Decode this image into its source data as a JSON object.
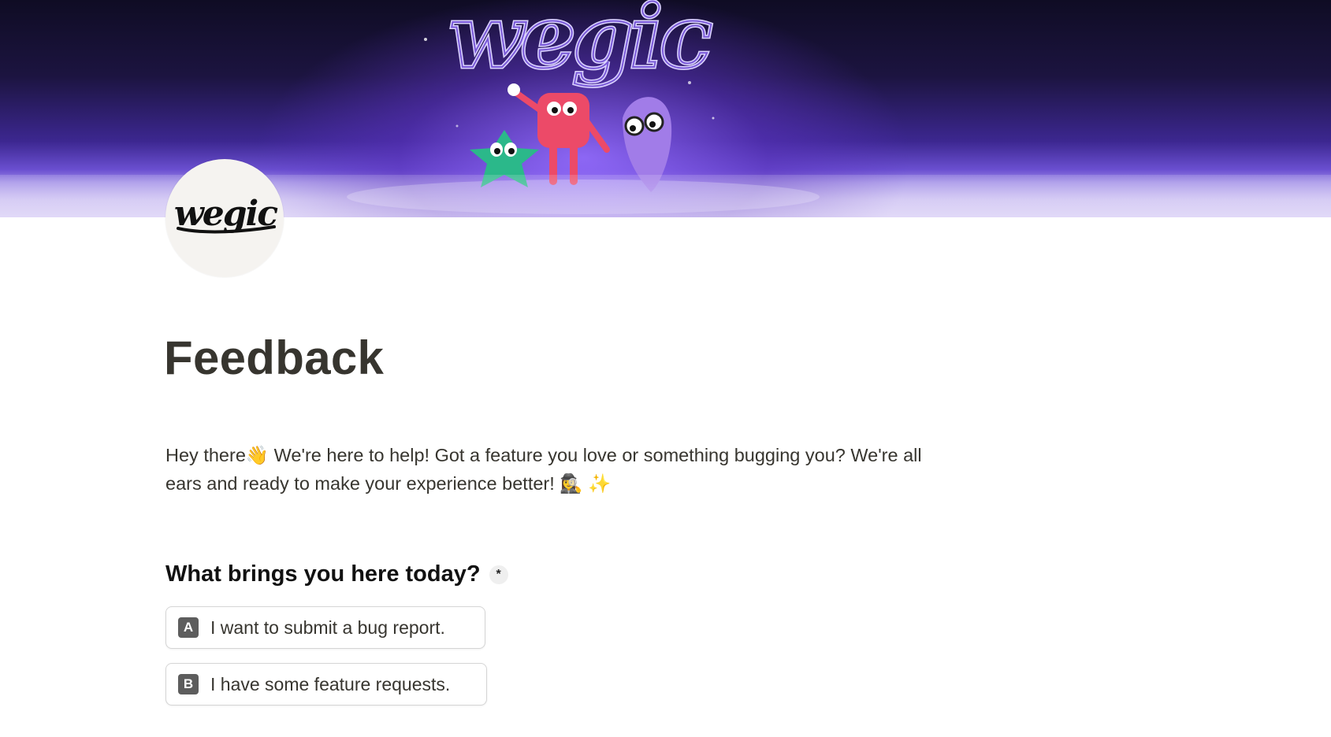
{
  "banner": {
    "logo_text": "wegic"
  },
  "avatar": {
    "logo_text": "wegic"
  },
  "page": {
    "title": "Feedback",
    "intro_line1": "Hey there👋 We're here to help! Got a feature you love or something bugging you? We're all",
    "intro_line2": "ears and ready to make your experience better! 🕵️‍♀️ ✨"
  },
  "question": {
    "label": "What brings you here today?",
    "required_mark": "*",
    "options": [
      {
        "key": "A",
        "label": "I want to submit a bug report."
      },
      {
        "key": "B",
        "label": "I have some feature requests."
      }
    ]
  }
}
